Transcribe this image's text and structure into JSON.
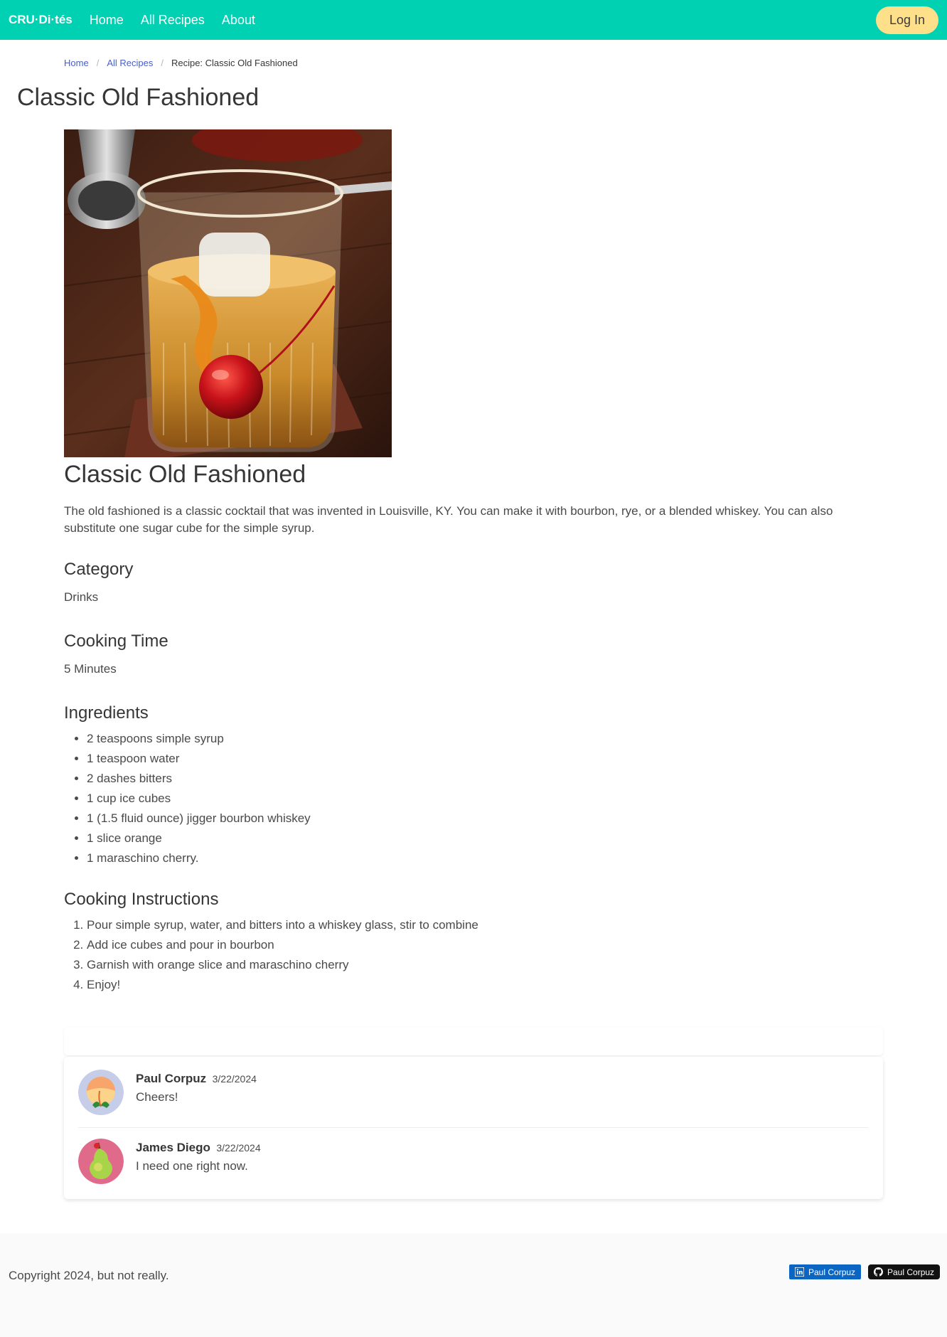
{
  "navbar": {
    "brand": "CRU·Di·tés",
    "links": [
      "Home",
      "All Recipes",
      "About"
    ],
    "login_label": "Log In"
  },
  "breadcrumb": {
    "home": "Home",
    "all_recipes": "All Recipes",
    "current": "Recipe: Classic Old Fashioned"
  },
  "page_title": "Classic Old Fashioned",
  "recipe": {
    "name": "Classic Old Fashioned",
    "description": "The old fashioned is a classic cocktail that was invented in Louisville, KY. You can make it with bourbon, rye, or a blended whiskey. You can also substitute one sugar cube for the simple syrup.",
    "category_heading": "Category",
    "category": "Drinks",
    "cooking_time_heading": "Cooking Time",
    "cooking_time": "5 Minutes",
    "ingredients_heading": "Ingredients",
    "ingredients": [
      "2 teaspoons simple syrup",
      "1 teaspoon water",
      "2 dashes bitters",
      "1 cup ice cubes",
      "1 (1.5 fluid ounce) jigger bourbon whiskey",
      "1 slice orange",
      "1 maraschino cherry."
    ],
    "instructions_heading": "Cooking Instructions",
    "instructions": [
      "Pour simple syrup, water, and bitters into a whiskey glass, stir to combine",
      "Add ice cubes and pour in bourbon",
      "Garnish with orange slice and maraschino cherry",
      "Enjoy!"
    ]
  },
  "comments": [
    {
      "author": "Paul Corpuz",
      "date": "3/22/2024",
      "text": "Cheers!",
      "avatar_icon": "peach-avatar-icon"
    },
    {
      "author": "James Diego",
      "date": "3/22/2024",
      "text": "I need one right now.",
      "avatar_icon": "pear-avatar-icon"
    }
  ],
  "footer": {
    "copyright": "Copyright 2024, but not really.",
    "linkedin_label": "Paul Corpuz",
    "github_label": "Paul Corpuz"
  },
  "colors": {
    "primary": "#00d1b2",
    "login_button": "#ffe08a",
    "link": "#485fc7",
    "linkedin": "#0a66c2"
  }
}
